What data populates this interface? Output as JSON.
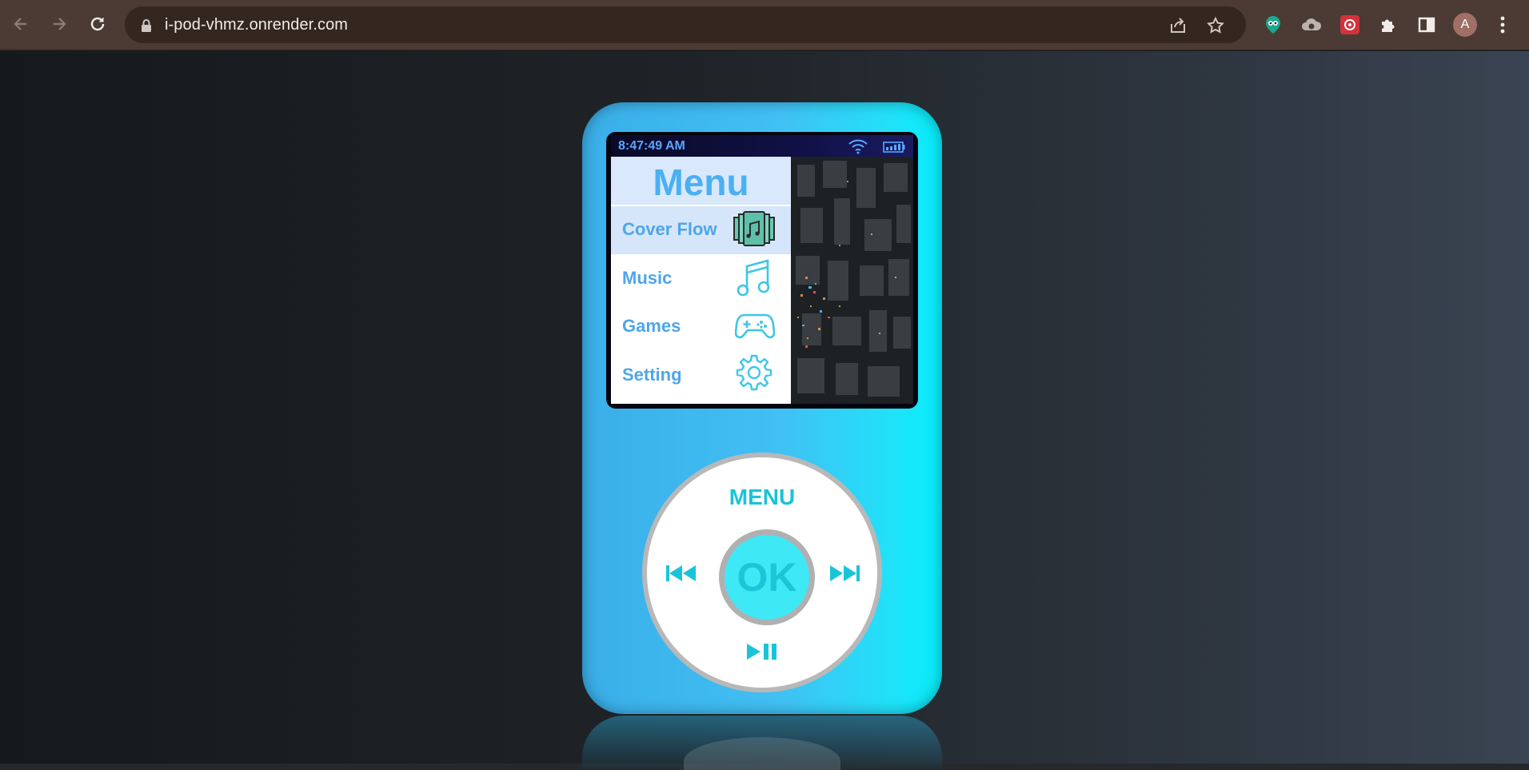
{
  "browser": {
    "url": "i-pod-vhmz.onrender.com",
    "profile_initial": "A",
    "icons": [
      "back-arrow-icon",
      "forward-arrow-icon",
      "reload-icon",
      "lock-icon",
      "share-icon",
      "star-icon",
      "extension-eye-icon",
      "extension-cloud-icon",
      "extension-red-icon",
      "puzzle-icon",
      "side-panel-icon",
      "more-vertical-icon"
    ]
  },
  "ipod": {
    "status": {
      "time": "8:47:49 AM"
    },
    "menu": {
      "title": "Menu",
      "items": [
        {
          "label": "Cover Flow",
          "icon": "cover-flow-icon",
          "active": true
        },
        {
          "label": "Music",
          "icon": "music-note-icon",
          "active": false
        },
        {
          "label": "Games",
          "icon": "gamepad-icon",
          "active": false
        },
        {
          "label": "Setting",
          "icon": "gear-icon",
          "active": false
        }
      ]
    },
    "wheel": {
      "menu_label": "MENU",
      "ok_label": "OK",
      "icons": [
        "rewind-icon",
        "fast-forward-icon",
        "play-pause-icon"
      ]
    }
  },
  "colors": {
    "accent": "#4ab0f2",
    "wheel_text": "#1ac4d8",
    "body_left": "#3aaee8",
    "body_right": "#06eefb"
  }
}
